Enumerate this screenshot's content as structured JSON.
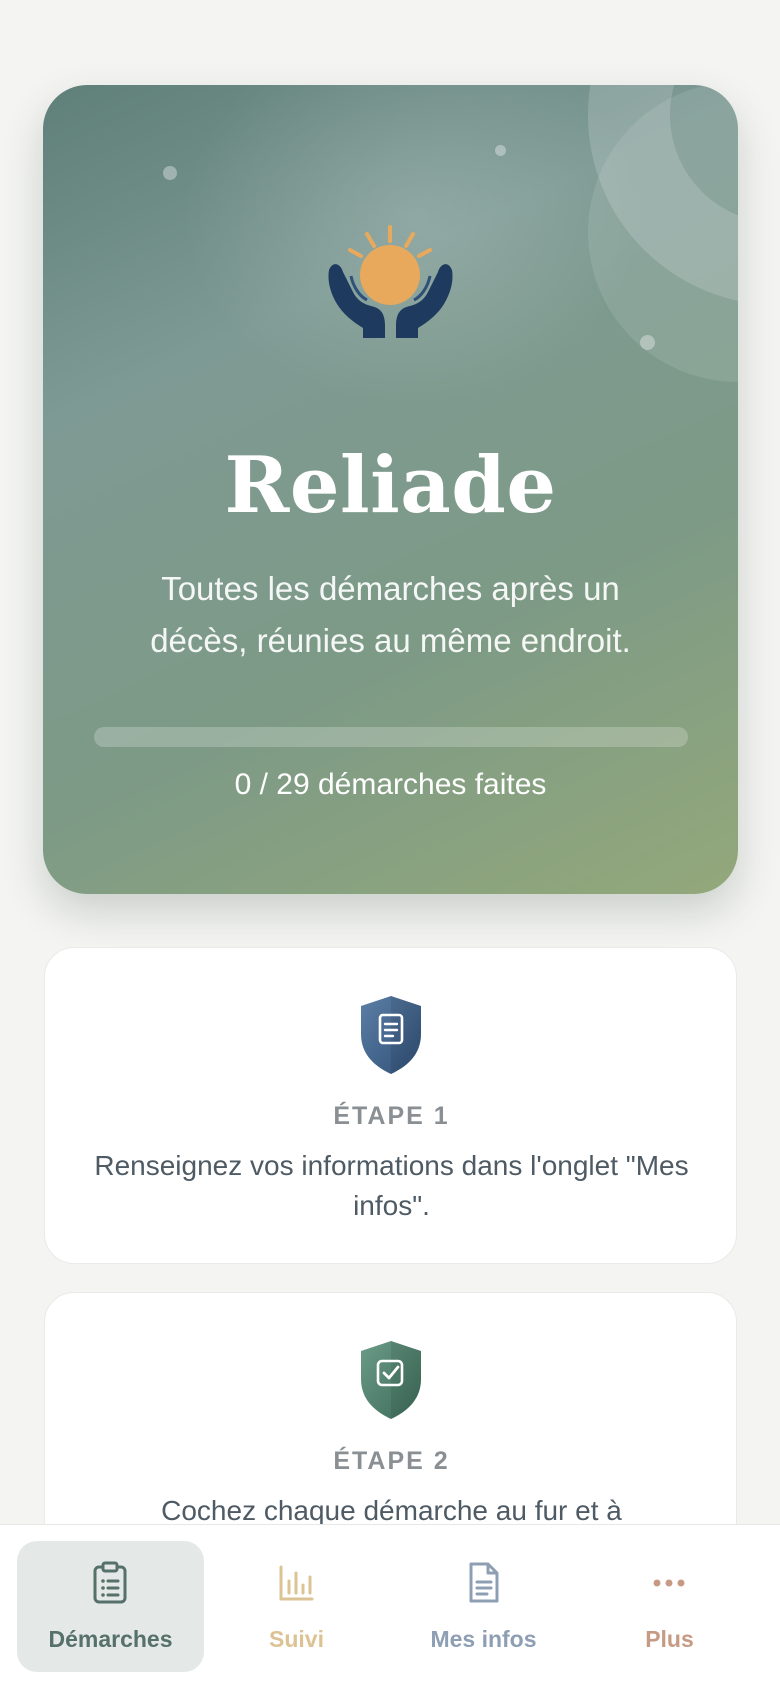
{
  "hero": {
    "title": "Reliade",
    "tagline": "Toutes les démarches après un décès, réunies au même endroit.",
    "progress_text": "0 / 29 démarches faites",
    "progress": {
      "done": 0,
      "total": 29
    },
    "logo_icon": "hands-sun-icon"
  },
  "steps": [
    {
      "label": "ÉTAPE 1",
      "text": "Renseignez vos informations dans l'onglet \"Mes infos\".",
      "icon": "document-shield-icon",
      "color": "#3f6189"
    },
    {
      "label": "ÉTAPE 2",
      "text": "Cochez chaque démarche au fur et à",
      "icon": "check-shield-icon",
      "color": "#4a7a68"
    }
  ],
  "nav": {
    "items": [
      {
        "label": "Démarches",
        "icon": "clipboard-list-icon",
        "color": "#56706a",
        "active": true
      },
      {
        "label": "Suivi",
        "icon": "bar-chart-icon",
        "color": "#dcc394",
        "active": false
      },
      {
        "label": "Mes infos",
        "icon": "document-icon",
        "color": "#8e9fb4",
        "active": false
      },
      {
        "label": "Plus",
        "icon": "more-dots-icon",
        "color": "#c79a84",
        "active": false
      }
    ]
  }
}
